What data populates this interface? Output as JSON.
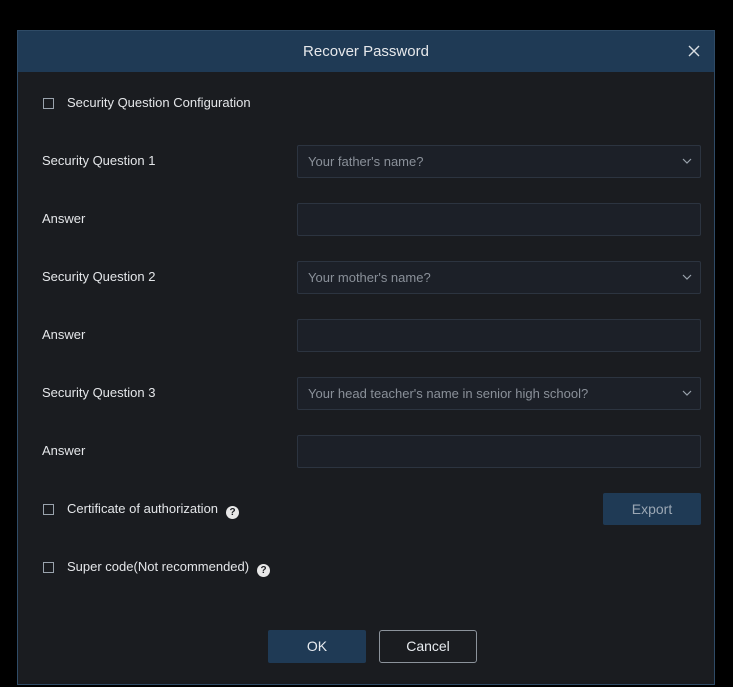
{
  "dialog": {
    "title": "Recover Password",
    "close_icon": "close-icon"
  },
  "security_question_config": {
    "label": "Security Question Configuration",
    "checked": false
  },
  "questions": [
    {
      "label": "Security Question 1",
      "selected": "Your father's name?",
      "answer_label": "Answer",
      "answer_value": ""
    },
    {
      "label": "Security Question 2",
      "selected": "Your mother's name?",
      "answer_label": "Answer",
      "answer_value": ""
    },
    {
      "label": "Security Question 3",
      "selected": "Your head teacher's name in senior high school?",
      "answer_label": "Answer",
      "answer_value": ""
    }
  ],
  "certificate": {
    "label": "Certificate of authorization",
    "checked": false,
    "help_icon": "help-circle-icon",
    "export_label": "Export"
  },
  "super_code": {
    "label": "Super code(Not recommended)",
    "checked": false,
    "help_icon": "help-circle-icon"
  },
  "footer": {
    "ok_label": "OK",
    "cancel_label": "Cancel"
  },
  "colors": {
    "titlebar": "#1f3a55",
    "dialog_bg": "#1a1c20",
    "field_bg": "#1c2028",
    "border": "#2f4b66"
  }
}
